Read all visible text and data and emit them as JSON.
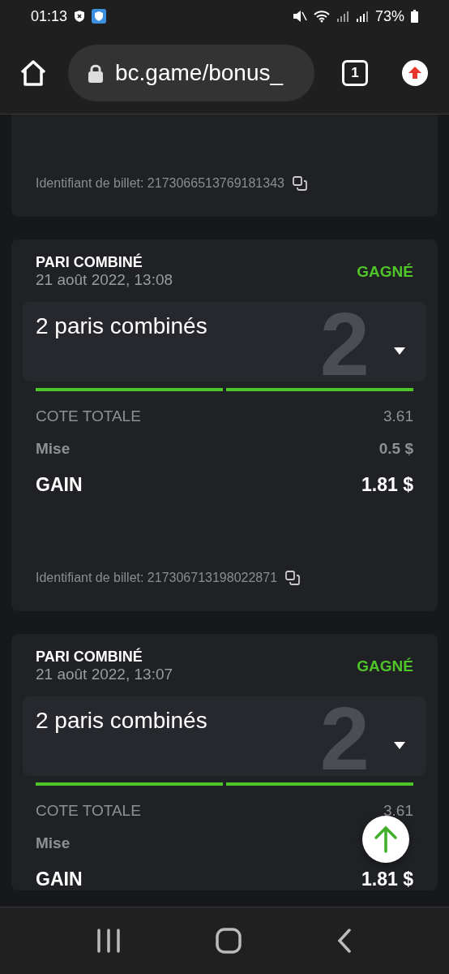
{
  "status_bar": {
    "time": "01:13",
    "battery": "73%"
  },
  "browser": {
    "url": "bc.game/bonus_",
    "tab_count": "1"
  },
  "bets": [
    {
      "kind": "partial",
      "ticket_label": "Identifiant de billet:",
      "ticket_id": "2173066513769181343"
    },
    {
      "kind": "full",
      "type": "PARI COMBINÉ",
      "date": "21 août 2022, 13:08",
      "status": "GAGNÉ",
      "won": true,
      "title": "2 paris combinés",
      "watermark": "2",
      "legs": [
        {
          "won": true
        },
        {
          "won": true
        }
      ],
      "odds_label": "COTE TOTALE",
      "odds": "3.61",
      "stake_label": "Mise",
      "stake": "0.5 $",
      "payout_label": "GAIN",
      "payout": "1.81 $",
      "ticket_label": "Identifiant de billet:",
      "ticket_id": "217306713198022871"
    },
    {
      "kind": "full",
      "type": "PARI COMBINÉ",
      "date": "21 août 2022, 13:07",
      "status": "GAGNÉ",
      "won": true,
      "title": "2 paris combinés",
      "watermark": "2",
      "legs": [
        {
          "won": true
        },
        {
          "won": true
        }
      ],
      "odds_label": "COTE TOTALE",
      "odds": "3.61",
      "stake_label": "Mise",
      "payout_label": "GAIN",
      "payout": "1.81 $"
    }
  ]
}
